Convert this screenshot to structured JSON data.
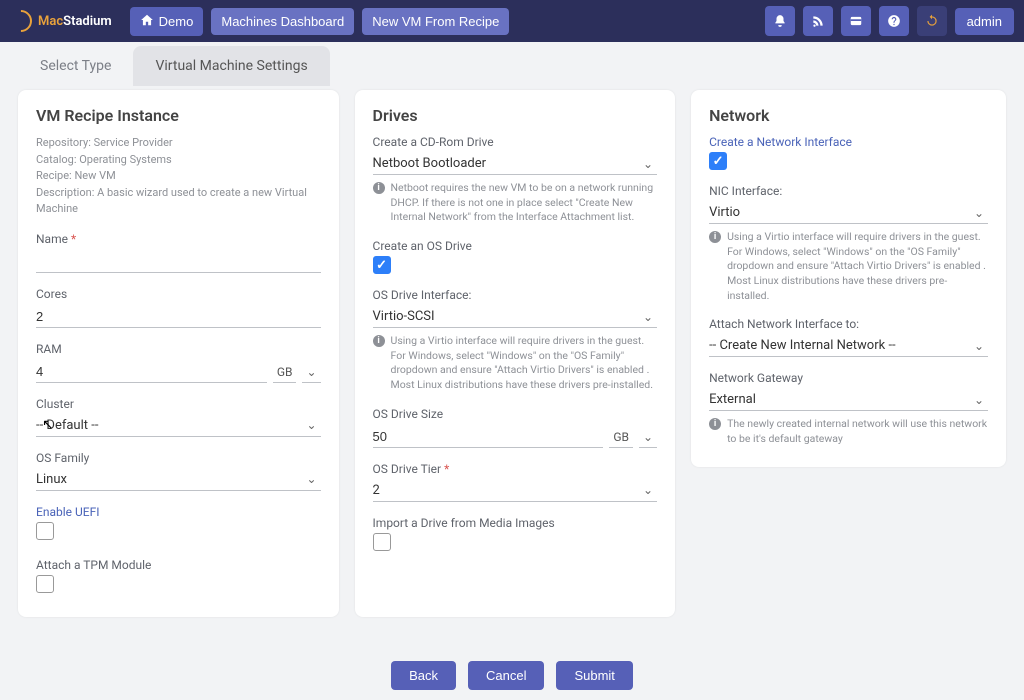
{
  "header": {
    "brand_a": "Mac",
    "brand_b": "Stadium",
    "demo": "Demo",
    "dashboard": "Machines Dashboard",
    "newvm": "New VM From Recipe",
    "admin": "admin"
  },
  "tabs": {
    "select_type": "Select Type",
    "vm_settings": "Virtual Machine Settings"
  },
  "vm": {
    "title": "VM Recipe Instance",
    "repo": "Repository: Service Provider",
    "catalog": "Catalog: Operating Systems",
    "recipe": "Recipe: New VM",
    "desc": "Description: A basic wizard used to create a new Virtual Machine",
    "name_label": "Name",
    "name_value": "",
    "cores_label": "Cores",
    "cores_value": "2",
    "ram_label": "RAM",
    "ram_value": "4",
    "ram_unit": "GB",
    "cluster_label": "Cluster",
    "cluster_value": "-- Default --",
    "osfam_label": "OS Family",
    "osfam_value": "Linux",
    "uefi_label": "Enable UEFI",
    "tpm_label": "Attach a TPM Module"
  },
  "drives": {
    "title": "Drives",
    "cd_label": "Create a CD-Rom Drive",
    "cd_value": "Netboot Bootloader",
    "cd_info": "Netboot requires the new VM to be on a network running DHCP. If there is not one in place select \"Create New Internal Network\" from the Interface Attachment list.",
    "osdrive_label": "Create an OS Drive",
    "iface_label": "OS Drive Interface:",
    "iface_value": "Virtio-SCSI",
    "iface_info": "Using a Virtio interface will require drivers in the guest. For Windows, select \"Windows\" on the \"OS Family\" dropdown and ensure \"Attach Virtio Drivers\" is enabled . Most Linux distributions have these drivers pre-installed.",
    "size_label": "OS Drive Size",
    "size_value": "50",
    "size_unit": "GB",
    "tier_label": "OS Drive Tier",
    "tier_value": "2",
    "import_label": "Import a Drive from Media Images"
  },
  "network": {
    "title": "Network",
    "create_label": "Create a Network Interface",
    "nic_label": "NIC Interface:",
    "nic_value": "Virtio",
    "nic_info": "Using a Virtio interface will require drivers in the guest. For Windows, select \"Windows\" on the \"OS Family\" dropdown and ensure \"Attach Virtio Drivers\" is enabled . Most Linux distributions have these drivers pre-installed.",
    "attach_label": "Attach Network Interface to:",
    "attach_value": "-- Create New Internal Network --",
    "gw_label": "Network Gateway",
    "gw_value": "External",
    "gw_info": "The newly created internal network will use this network to be it's default gateway"
  },
  "footer": {
    "back": "Back",
    "cancel": "Cancel",
    "submit": "Submit"
  }
}
